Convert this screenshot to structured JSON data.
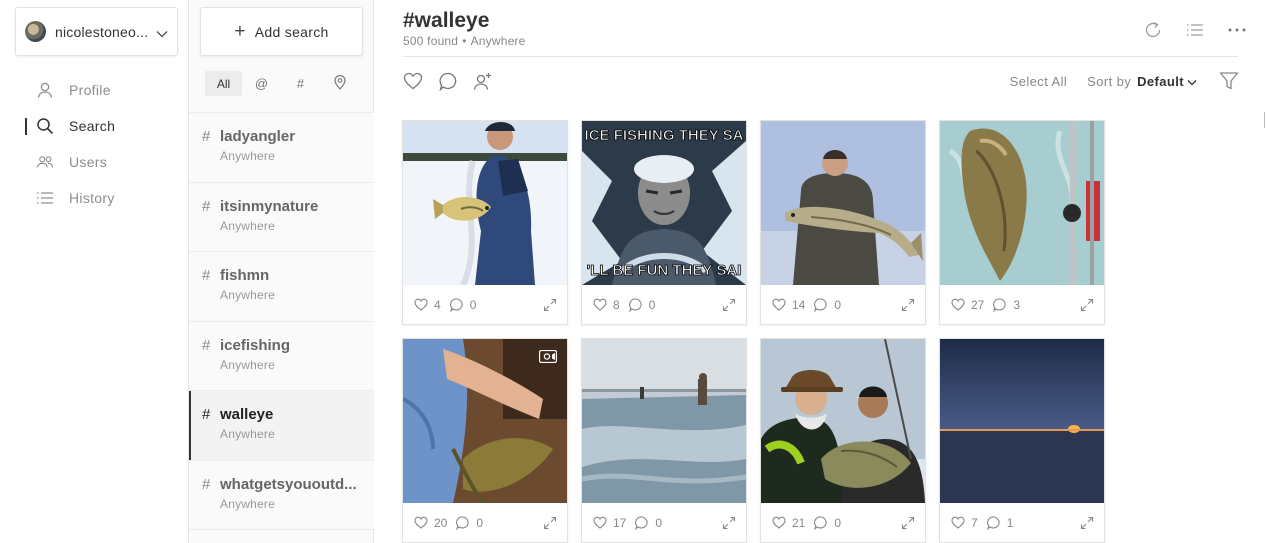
{
  "account": {
    "name": "nicolestoneo..."
  },
  "nav": {
    "items": [
      {
        "label": "Profile",
        "icon": "user-icon",
        "active": false
      },
      {
        "label": "Search",
        "icon": "search-icon",
        "active": true
      },
      {
        "label": "Users",
        "icon": "users-icon",
        "active": false
      },
      {
        "label": "History",
        "icon": "list-icon",
        "active": false
      }
    ]
  },
  "searches": {
    "add_label": "Add search",
    "filters": [
      "All",
      "@",
      "#",
      "location-pin-icon"
    ],
    "items": [
      {
        "tag": "ladyangler",
        "location": "Anywhere",
        "active": false
      },
      {
        "tag": "itsinmynature",
        "location": "Anywhere",
        "active": false
      },
      {
        "tag": "fishmn",
        "location": "Anywhere",
        "active": false
      },
      {
        "tag": "icefishing",
        "location": "Anywhere",
        "active": false
      },
      {
        "tag": "walleye",
        "location": "Anywhere",
        "active": true
      },
      {
        "tag": "whatgetsyououtd...",
        "location": "Anywhere",
        "active": false
      }
    ]
  },
  "main": {
    "title": "#walleye",
    "count": "500 found",
    "dot": "•",
    "location": "Anywhere",
    "select_all": "Select All",
    "sort_label": "Sort by",
    "sort_value": "Default",
    "posts": [
      {
        "likes": "4",
        "comments": "0"
      },
      {
        "likes": "8",
        "comments": "0",
        "meme_top": "ICE FISHING THEY SA",
        "meme_bottom": "'LL BE FUN THEY SAI"
      },
      {
        "likes": "14",
        "comments": "0"
      },
      {
        "likes": "27",
        "comments": "3"
      },
      {
        "likes": "20",
        "comments": "0",
        "video": true
      },
      {
        "likes": "17",
        "comments": "0"
      },
      {
        "likes": "21",
        "comments": "0"
      },
      {
        "likes": "7",
        "comments": "1"
      }
    ]
  },
  "colors": {
    "active_text": "#333333",
    "muted_text": "#888888",
    "border": "#e2e2e2",
    "list_bg": "#fafafa"
  }
}
